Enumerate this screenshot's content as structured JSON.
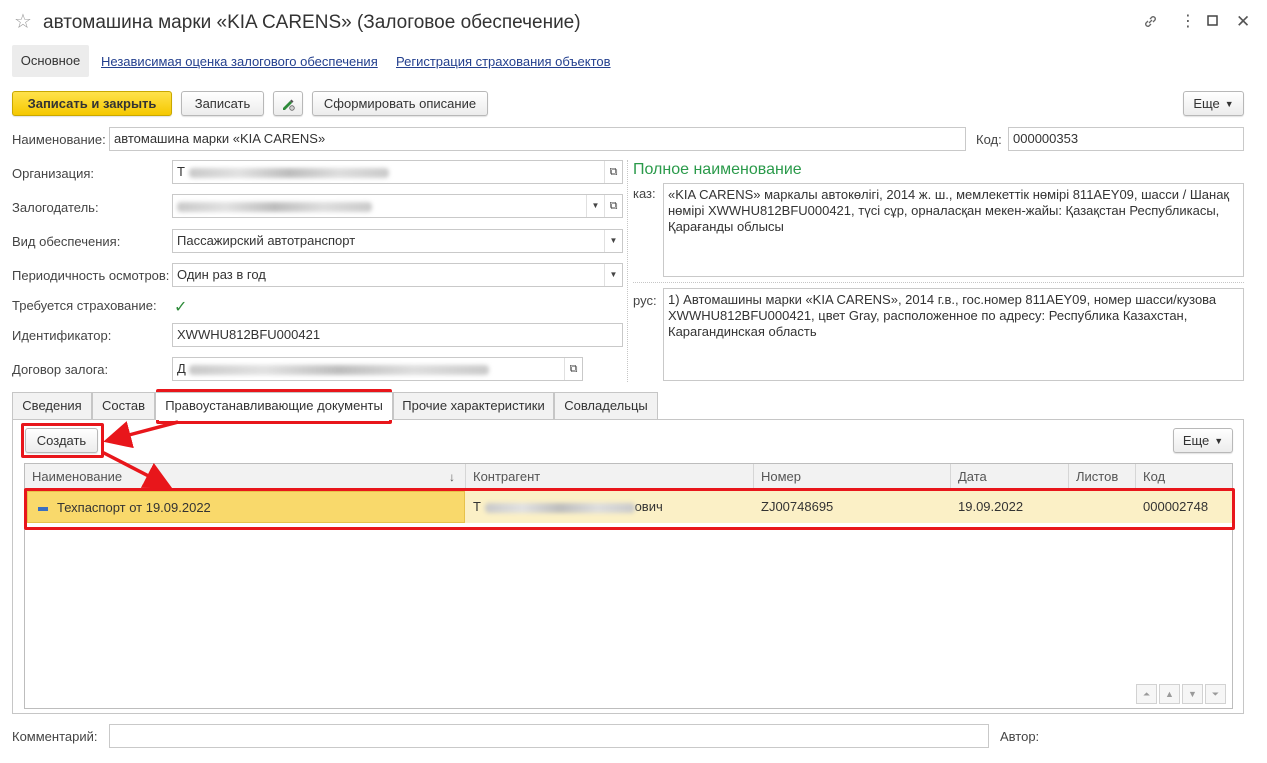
{
  "window": {
    "title": "автомашина марки «KIA CARENS» (Залоговое обеспечение)",
    "controls": [
      "link-icon",
      "more-icon",
      "minimize-icon",
      "maximize-icon",
      "close-icon"
    ]
  },
  "nav": {
    "active": "Основное",
    "links": [
      "Независимая оценка залогового обеспечения",
      "Регистрация страхования объектов"
    ]
  },
  "toolbar": {
    "save_close": "Записать и закрыть",
    "save": "Записать",
    "describe": "Сформировать описание",
    "more": "Еще"
  },
  "form": {
    "name_label": "Наименование:",
    "name_value": "автомашина марки «KIA CARENS»",
    "code_label": "Код:",
    "code_value": "000000353",
    "org_label": "Организация:",
    "org_prefix": "Т",
    "pledger_label": "Залогодатель:",
    "type_label": "Вид обеспечения:",
    "type_value": "Пассажирский автотранспорт",
    "period_label": "Периодичность осмотров:",
    "period_value": "Один раз в год",
    "insurance_label": "Требуется страхование:",
    "insurance_checked": true,
    "id_label": "Идентификатор:",
    "id_value": "XWWHU812BFU000421",
    "contract_label": "Договор залога:",
    "contract_prefix": "Д"
  },
  "full_name": {
    "title": "Полное наименование",
    "kaz_label": "каз:",
    "kaz_text": "«KIA CARENS» маркалы автокөлігі, 2014 ж. ш., мемлекеттік нөмірі 811AEY09, шасси / Шанақ нөмірі XWWHU812BFU000421, түсі сұр, орналасқан мекен-жайы: Қазақстан Республикасы, Қарағанды облысы",
    "rus_label": "рус:",
    "rus_text": "1)    Автомашины марки «KIA CARENS», 2014 г.в., гос.номер 811AEY09, номер шасси/кузова XWWHU812BFU000421, цвет Gray, расположенное по адресу: Республика Казахстан, Карагандинская область"
  },
  "tabs": [
    "Сведения",
    "Состав",
    "Правоустанавливающие документы",
    "Прочие характеристики",
    "Совладельцы"
  ],
  "tab_toolbar": {
    "create": "Создать",
    "more": "Еще"
  },
  "table": {
    "columns": [
      "Наименование",
      "Контрагент",
      "Номер",
      "Дата",
      "Листов",
      "Код"
    ],
    "rows": [
      {
        "name": "Техпаспорт от 19.09.2022",
        "contractor_prefix": "Т",
        "contractor_suffix": "ович",
        "number": "ZJ00748695",
        "date": "19.09.2022",
        "sheets": "",
        "code": "000002748"
      }
    ]
  },
  "bottom": {
    "comment_label": "Комментарий:",
    "author_label": "Автор:"
  },
  "colors": {
    "accent_green": "#2a9a4a",
    "primary_yellow": "#f5c800",
    "annotation_red": "#e8161b",
    "link_blue": "#24408e"
  }
}
